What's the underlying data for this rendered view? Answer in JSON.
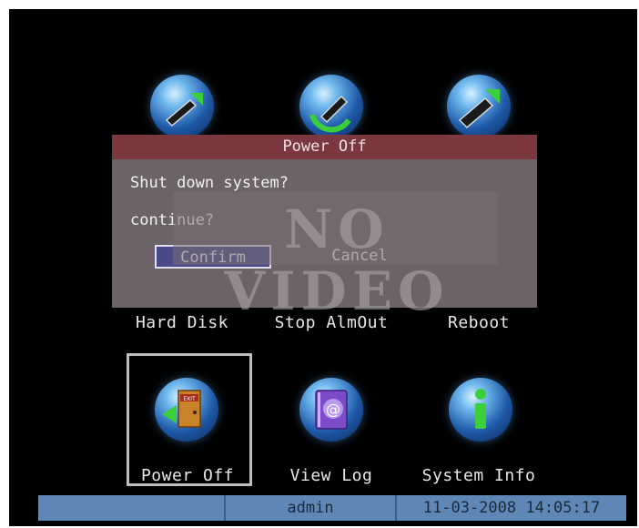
{
  "menu": {
    "top_items": [
      {
        "label": "Hard Disk",
        "icon": "hard-disk-icon"
      },
      {
        "label": "Stop AlmOut",
        "icon": "stop-alarm-output-icon"
      },
      {
        "label": "Reboot",
        "icon": "reboot-icon"
      }
    ],
    "bottom_items": [
      {
        "label": "Power Off",
        "icon": "power-off-icon",
        "selected": true,
        "icon_badge": "EXIT"
      },
      {
        "label": "View Log",
        "icon": "view-log-icon",
        "icon_badge": "@"
      },
      {
        "label": "System Info",
        "icon": "system-info-icon"
      }
    ]
  },
  "dialog": {
    "title": "Power Off",
    "message": "Shut down system?",
    "prompt": "continue?",
    "confirm_label": "Confirm",
    "cancel_label": "Cancel"
  },
  "overlay": {
    "text": "NO VIDEO"
  },
  "status_bar": {
    "user": "admin",
    "datetime": "11-03-2008 14:05:17"
  },
  "colors": {
    "screen_bg": "#000000",
    "dialog_bg": "#6b6367",
    "dialog_header": "#7c383f",
    "status_bar": "#5f87b5",
    "confirm_button": "#4a4a8a"
  }
}
